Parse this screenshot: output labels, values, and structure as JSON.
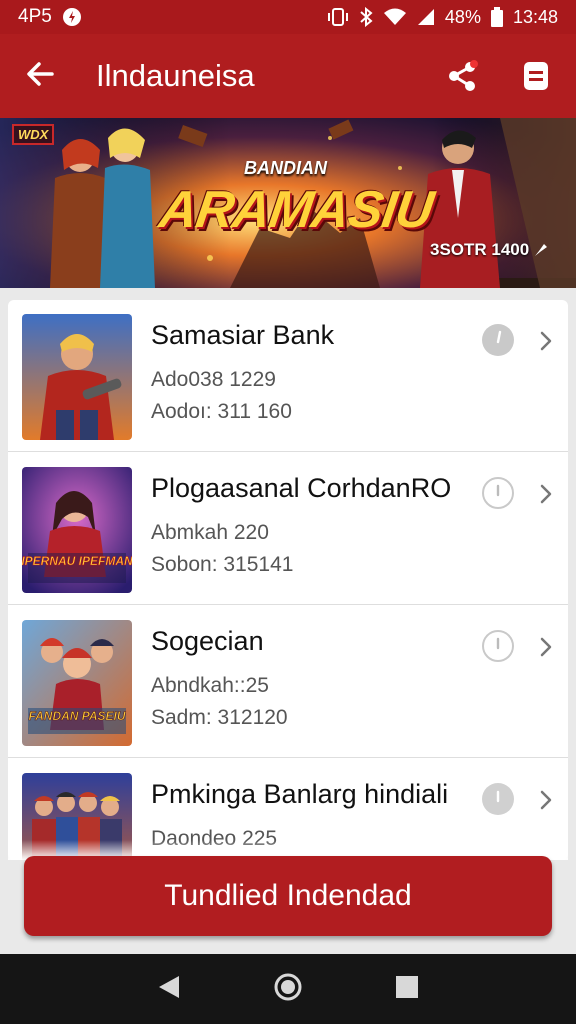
{
  "status_bar": {
    "carrier": "4P5",
    "battery_percent": "48%",
    "time": "13:48",
    "icons": [
      "notification-icon",
      "vibrate-icon",
      "bluetooth-icon",
      "wifi-icon",
      "signal-icon",
      "battery-icon"
    ]
  },
  "app_bar": {
    "title": "Ilndauneisa",
    "icons": [
      "back-arrow-icon",
      "share-icon",
      "menu-icon"
    ]
  },
  "banner": {
    "corner_badge": "WDX",
    "subtitle": "BANDIAN",
    "title": "ARAMASIU",
    "counter": "3SOTR 1400"
  },
  "games": [
    {
      "title": "Samasiar Bank",
      "line1": "Ado038 1229",
      "line2": "Aodoı: 311 160"
    },
    {
      "title": "Plogaasanal CorhdanRO",
      "line1": "Abmkah 220",
      "line2": "Sobon: 315141"
    },
    {
      "title": "Sogecian",
      "line1": "Abndkah::25",
      "line2": "Sadm: 312120"
    },
    {
      "title": "Pmkinga Banlarg hindiali",
      "line1": "Daondeo 225",
      "line2": ""
    }
  ],
  "thumb_labels": [
    "",
    "IPERNAU IPEFMAN",
    "FANDAN PASEIU",
    ""
  ],
  "cta": {
    "label": "Tundlied Indendad"
  },
  "colors": {
    "primary": "#b01d1f",
    "status_bar": "#a9191c",
    "nav_bar": "#151515",
    "accent_gold": "#ffd23a"
  }
}
